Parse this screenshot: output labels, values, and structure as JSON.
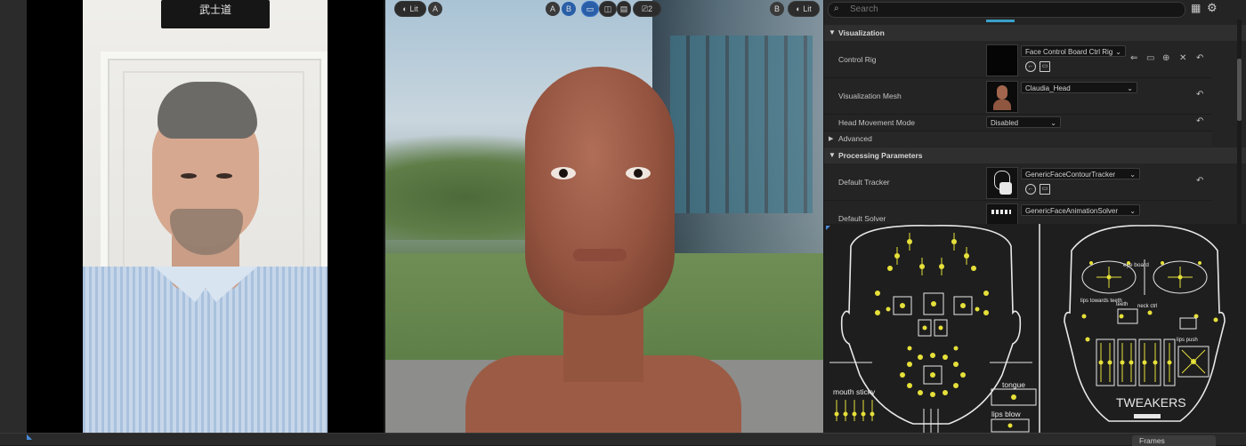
{
  "video": {
    "plaque_text": "武士道"
  },
  "viewport": {
    "left_controls": {
      "lit_label": "Lit",
      "camera_label": "A"
    },
    "center_controls": {
      "a_label": "A",
      "b_label": "B",
      "count_label": "2"
    },
    "right_controls": {
      "b_label": "B",
      "lit_label": "Lit"
    },
    "colors": {
      "active_blue": "#2a5fa8"
    }
  },
  "details": {
    "search_placeholder": "Search",
    "categories": {
      "visualization": "Visualization",
      "advanced": "Advanced",
      "processing": "Processing Parameters"
    },
    "control_rig": {
      "label": "Control Rig",
      "value": "Face Control Board Ctrl Rig"
    },
    "visualization_mesh": {
      "label": "Visualization Mesh",
      "value": "Claudia_Head"
    },
    "head_movement": {
      "label": "Head Movement Mode",
      "value": "Disabled"
    },
    "default_tracker": {
      "label": "Default Tracker",
      "value": "GenericFaceContourTracker"
    },
    "default_solver": {
      "label": "Default Solver",
      "value": "GenericFaceAnimationSolver"
    }
  },
  "board": {
    "labels": {
      "mouth_sticky": "mouth sticky",
      "tongue": "tongue",
      "lips_blow": "lips blow",
      "eye_board": "eye board",
      "teeth": "teeth",
      "neck_ctrl": "neck ctrl",
      "lips_towards": "lips towards teeth",
      "tweakers": "TWEAKERS",
      "lips_push": "lips push"
    },
    "colors": {
      "dot": "#e6e03a",
      "line": "#e8e8e8",
      "bg": "#1e1e1e"
    }
  },
  "bottom": {
    "frames_tab": "Frames"
  }
}
